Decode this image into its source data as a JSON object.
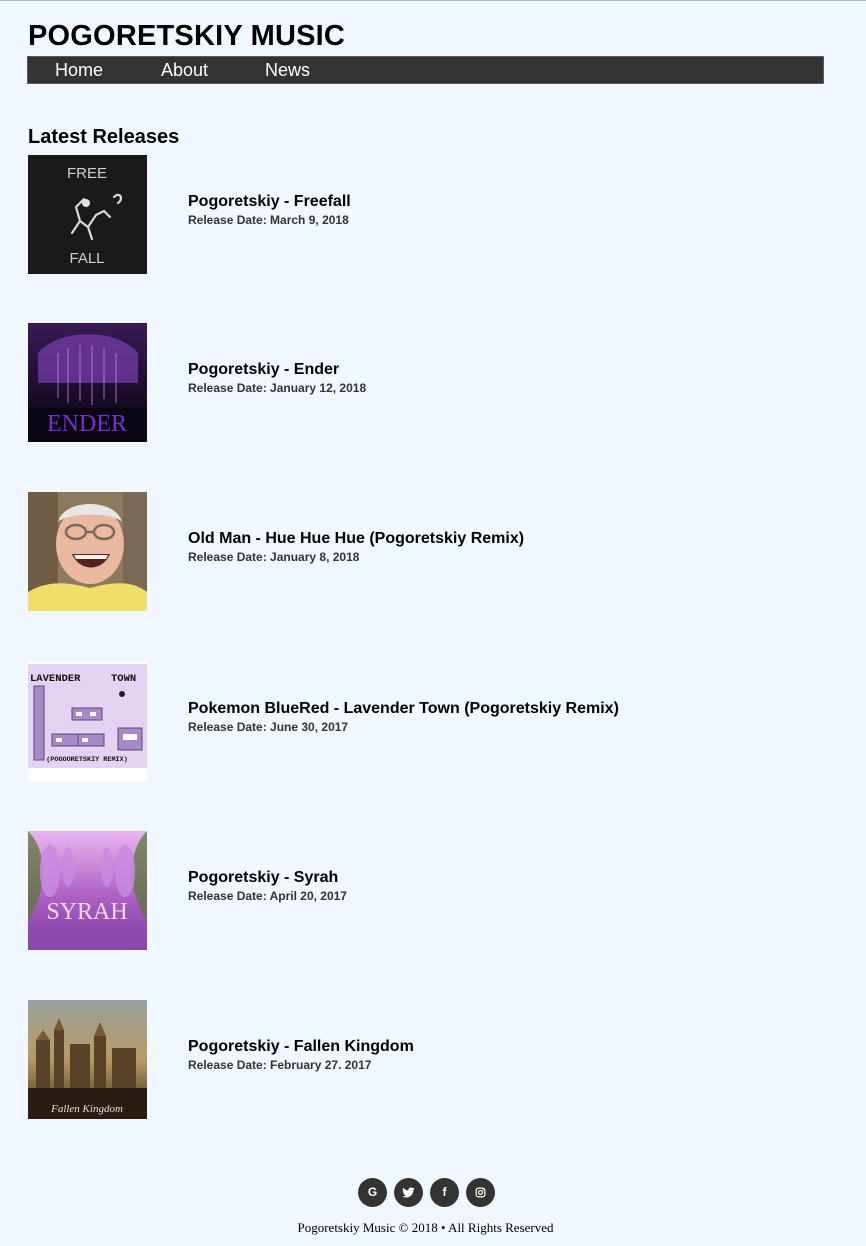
{
  "site": {
    "title": "POGORETSKIY MUSIC"
  },
  "nav": {
    "items": [
      {
        "label": "Home"
      },
      {
        "label": "About"
      },
      {
        "label": "News"
      }
    ]
  },
  "main": {
    "heading": "Latest Releases",
    "releases": [
      {
        "title": "Pogoretskiy - Freefall",
        "date": "Release Date: March 9, 2018",
        "cover_text": [
          "FREE",
          "FALL"
        ]
      },
      {
        "title": "Pogoretskiy - Ender",
        "date": "Release Date: January 12, 2018",
        "cover_text": [
          "ENDER"
        ]
      },
      {
        "title": "Old Man - Hue Hue Hue (Pogoretskiy Remix)",
        "date": "Release Date: January 8, 2018",
        "cover_text": []
      },
      {
        "title": "Pokemon BlueRed - Lavender Town (Pogoretskiy Remix)",
        "date": "Release Date: June 30, 2017",
        "cover_text": [
          "LAVENDER",
          "TOWN",
          "(POGOORETSKIY REMIX)"
        ]
      },
      {
        "title": "Pogoretskiy - Syrah",
        "date": "Release Date: April 20, 2017",
        "cover_text": [
          "SYRAH"
        ]
      },
      {
        "title": "Pogoretskiy - Fallen Kingdom",
        "date": "Release Date: February 27. 2017",
        "cover_text": [
          "Fallen Kingdom"
        ]
      }
    ]
  },
  "footer": {
    "social": [
      {
        "icon": "google-icon",
        "glyph": "G"
      },
      {
        "icon": "twitter-icon"
      },
      {
        "icon": "facebook-icon",
        "glyph": "f"
      },
      {
        "icon": "instagram-icon"
      }
    ],
    "copyright": "Pogoretskiy Music © 2018 • All Rights Reserved"
  },
  "colors": {
    "page_background": "#f0f7fe",
    "nav_background": "#333333",
    "nav_text": "#ffffff",
    "social_button": "#333333"
  }
}
